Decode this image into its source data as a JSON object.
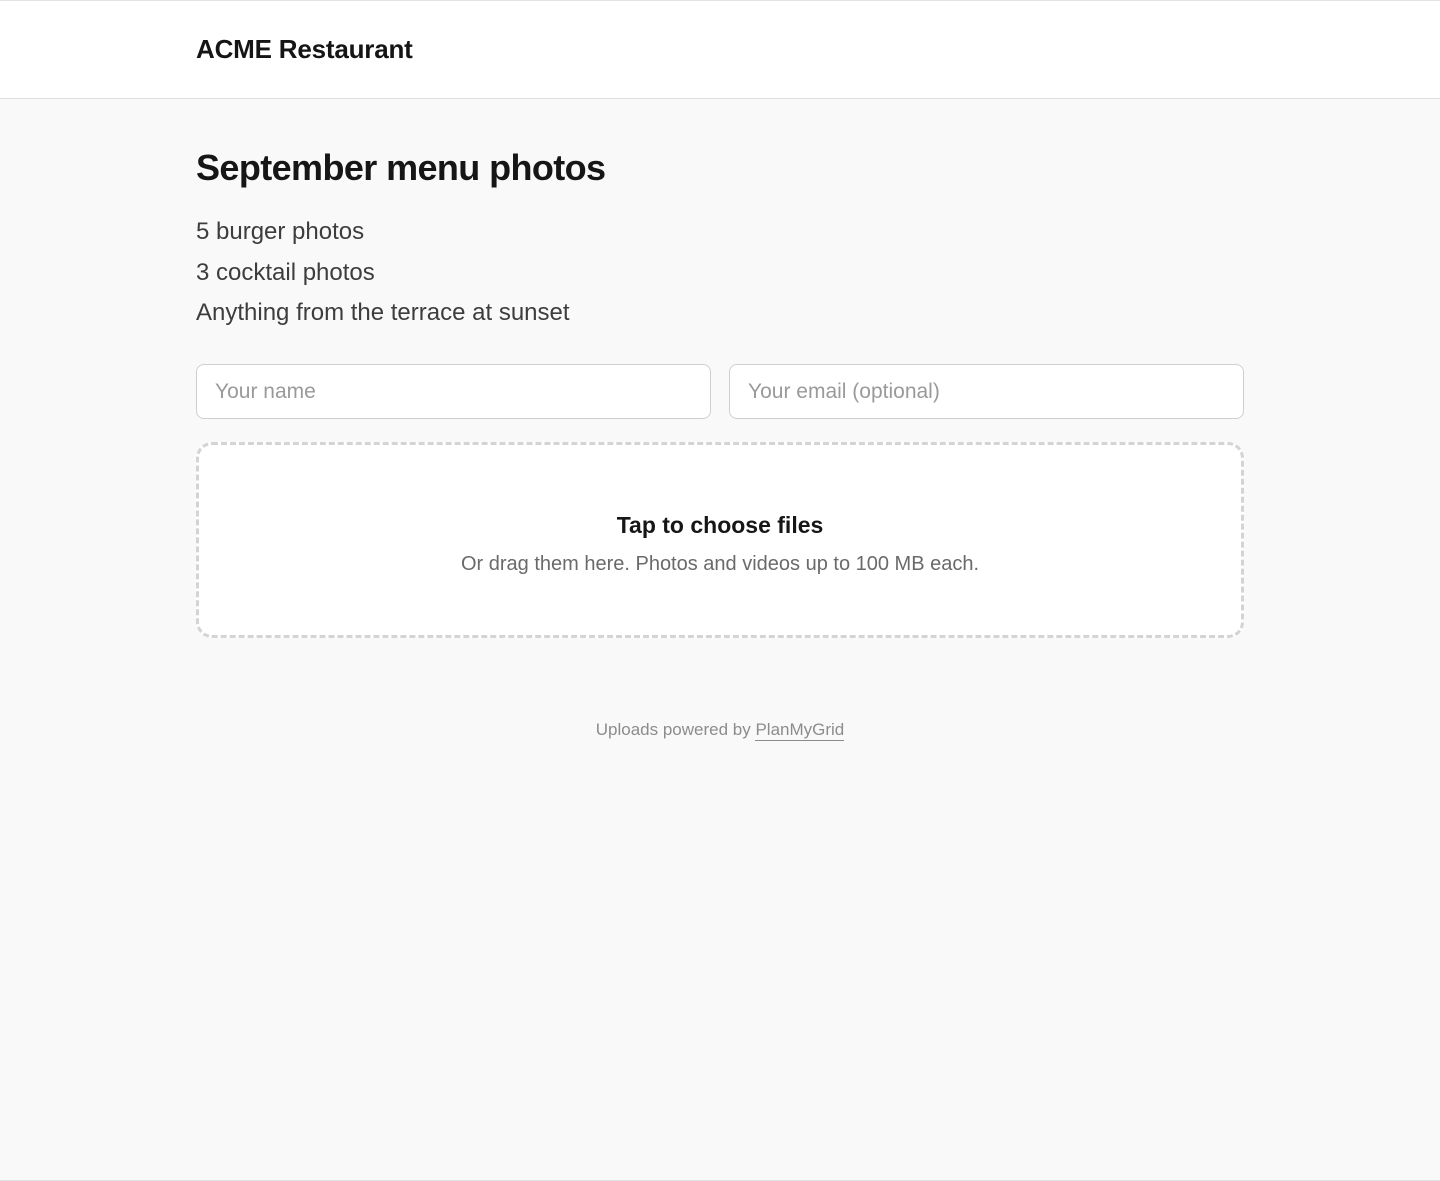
{
  "header": {
    "brand": "ACME Restaurant"
  },
  "main": {
    "title": "September menu photos",
    "brief": [
      "5 burger photos",
      "3 cocktail photos",
      "Anything from the terrace at sunset"
    ],
    "form": {
      "name_placeholder": "Your name",
      "name_value": "",
      "email_placeholder": "Your email (optional)",
      "email_value": ""
    },
    "dropzone": {
      "title": "Tap to choose files",
      "hint": "Or drag them here. Photos and videos up to 100 MB each."
    }
  },
  "footer": {
    "prefix": "Uploads powered by",
    "link_label": "PlanMyGrid"
  },
  "colors": {
    "page_background": "#f9f9f9",
    "surface": "#ffffff",
    "border": "#cfcfcf",
    "dashed_border": "#d4d4d4",
    "muted_text": "#8c8c8c"
  }
}
